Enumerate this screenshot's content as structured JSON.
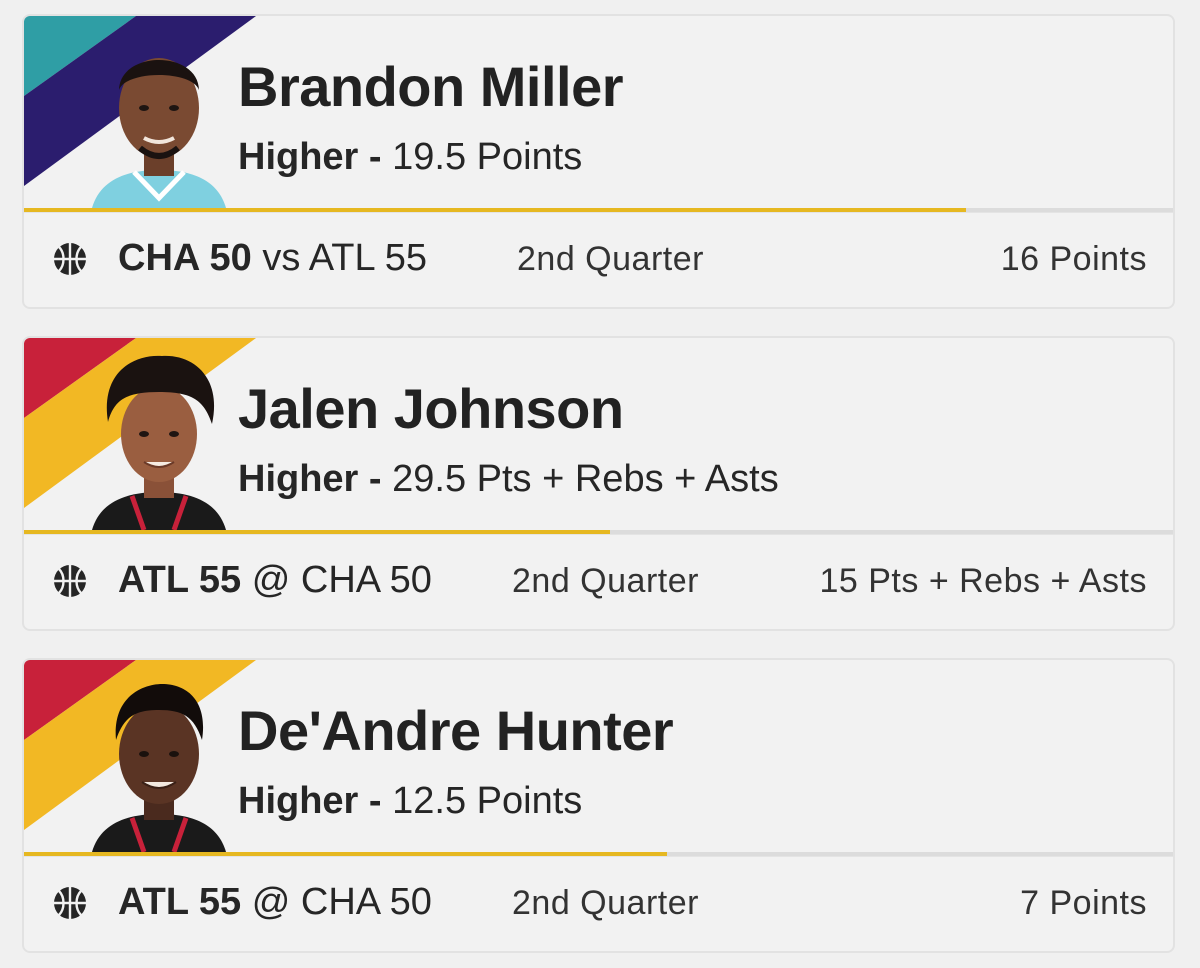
{
  "cards": [
    {
      "player": "Brandon Miller",
      "direction": "Higher",
      "separator": "-",
      "line": "19.5 Points",
      "team_bold": "CHA 50",
      "matchup_rest": "vs ATL 55",
      "period": "2nd Quarter",
      "current_stat": "16 Points",
      "progress": 0.82,
      "colors": {
        "stripe_a": "#2f9ea5",
        "stripe_b": "#2b1d6e",
        "jersey": "#7fd0e0",
        "progress": "#e6b821"
      }
    },
    {
      "player": "Jalen Johnson",
      "direction": "Higher",
      "separator": "-",
      "line": "29.5 Pts + Rebs + Asts",
      "team_bold": "ATL 55",
      "matchup_rest": "@ CHA 50",
      "period": "2nd Quarter",
      "current_stat": "15 Pts + Rebs + Asts",
      "progress": 0.51,
      "colors": {
        "stripe_a": "#c8213a",
        "stripe_b": "#f2b824",
        "jersey": "#1a1a1a",
        "progress": "#e6b821"
      }
    },
    {
      "player": "De'Andre Hunter",
      "direction": "Higher",
      "separator": "-",
      "line": "12.5 Points",
      "team_bold": "ATL 55",
      "matchup_rest": "@ CHA 50",
      "period": "2nd Quarter",
      "current_stat": "7 Points",
      "progress": 0.56,
      "colors": {
        "stripe_a": "#c8213a",
        "stripe_b": "#f2b824",
        "jersey": "#1a1a1a",
        "progress": "#e6b821"
      }
    }
  ],
  "icons": {
    "sport": "basketball-icon",
    "photo": "player-headshot"
  }
}
